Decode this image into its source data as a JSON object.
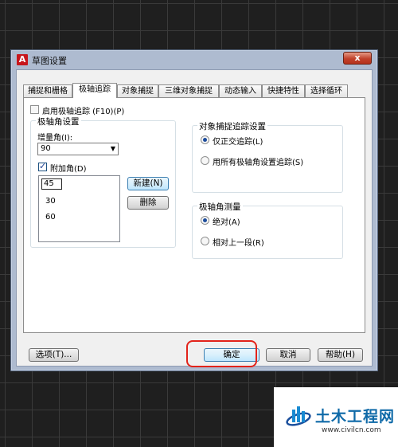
{
  "dialog": {
    "title": "草图设置",
    "app_icon": "A",
    "close_icon": "x"
  },
  "tabs": [
    {
      "label": "捕捉和栅格"
    },
    {
      "label": "极轴追踪",
      "active": true
    },
    {
      "label": "对象捕捉"
    },
    {
      "label": "三维对象捕捉"
    },
    {
      "label": "动态输入"
    },
    {
      "label": "快捷特性"
    },
    {
      "label": "选择循环"
    }
  ],
  "polar": {
    "enable_label": "启用极轴追踪 (F10)(P)",
    "enable_checked": false,
    "angle_settings_title": "极轴角设置",
    "increment_label": "增量角(I):",
    "increment_value": "90",
    "additional_label": "附加角(D)",
    "additional_checked": true,
    "angles": [
      "45",
      "30",
      "60"
    ],
    "new_button": "新建(N)",
    "delete_button": "删除"
  },
  "object_snap_tracking": {
    "title": "对象捕捉追踪设置",
    "options": [
      {
        "label": "仅正交追踪(L)",
        "checked": true
      },
      {
        "label": "用所有极轴角设置追踪(S)",
        "checked": false
      }
    ]
  },
  "polar_measurement": {
    "title": "极轴角测量",
    "options": [
      {
        "label": "绝对(A)",
        "checked": true
      },
      {
        "label": "相对上一段(R)",
        "checked": false
      }
    ]
  },
  "footer": {
    "options_button": "选项(T)...",
    "ok_button": "确定",
    "cancel_button": "取消",
    "help_button": "帮助(H)"
  },
  "colors": {
    "highlight": "#e2231a",
    "title_bar": "#aebbd0"
  },
  "watermark": {
    "name": "土木工程网",
    "url": "www.civilcn.com"
  }
}
